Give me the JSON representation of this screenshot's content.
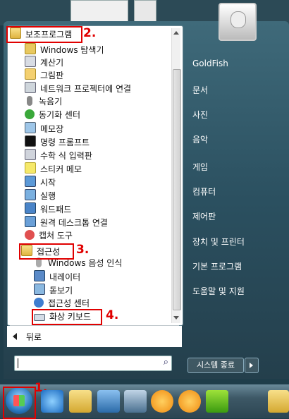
{
  "colors": {
    "accent_red": "#e00000",
    "menu_bg": "#2b5060"
  },
  "programs": [
    {
      "label": "보조프로그램",
      "icon": "folder-icon",
      "level": 0
    },
    {
      "label": "Windows 탐색기",
      "icon": "explorer-icon",
      "level": 1
    },
    {
      "label": "계산기",
      "icon": "calculator-icon",
      "level": 1
    },
    {
      "label": "그림판",
      "icon": "paint-icon",
      "level": 1
    },
    {
      "label": "네트워크 프로젝터에 연결",
      "icon": "projector-icon",
      "level": 1
    },
    {
      "label": "녹음기",
      "icon": "microphone-icon",
      "level": 1
    },
    {
      "label": "동기화 센터",
      "icon": "sync-icon",
      "level": 1
    },
    {
      "label": "메모장",
      "icon": "notepad-icon",
      "level": 1
    },
    {
      "label": "명령 프롬프트",
      "icon": "cmd-icon",
      "level": 1
    },
    {
      "label": "수학 식 입력판",
      "icon": "math-icon",
      "level": 1
    },
    {
      "label": "스티커 메모",
      "icon": "sticky-note-icon",
      "level": 1
    },
    {
      "label": "시작",
      "icon": "start-icon",
      "level": 1
    },
    {
      "label": "실행",
      "icon": "run-icon",
      "level": 1
    },
    {
      "label": "워드패드",
      "icon": "wordpad-icon",
      "level": 1
    },
    {
      "label": "원격 데스크톱 연결",
      "icon": "remote-desktop-icon",
      "level": 1
    },
    {
      "label": "캡처 도구",
      "icon": "snipping-icon",
      "level": 1
    },
    {
      "label": "접근성",
      "icon": "folder-icon",
      "level": 1
    },
    {
      "label": "Windows 음성 인식",
      "icon": "mic-icon",
      "level": 2
    },
    {
      "label": "내레이터",
      "icon": "narrator-icon",
      "level": 2
    },
    {
      "label": "돋보기",
      "icon": "magnifier-icon",
      "level": 2
    },
    {
      "label": "접근성 센터",
      "icon": "accessibility-icon",
      "level": 2
    },
    {
      "label": "화상 키보드",
      "icon": "keyboard-icon",
      "level": 2
    }
  ],
  "steps": {
    "s1": "1.",
    "s2": "2.",
    "s3": "3.",
    "s4": "4."
  },
  "back_label": "뒤로",
  "search": {
    "value": "",
    "icon": "search-icon"
  },
  "right_panel": {
    "user": "GoldFish",
    "items": [
      "문서",
      "사진",
      "음악",
      "게임",
      "컴퓨터",
      "제어판",
      "장치 및 프린터",
      "기본 프로그램",
      "도움말 및 지원"
    ]
  },
  "shutdown_label": "시스템 종료",
  "taskbar_icons": [
    "ie-icon",
    "folder-icon",
    "desktop-icon",
    "network-icon",
    "goldfish-icon",
    "goldfish-icon",
    "big-icon"
  ]
}
